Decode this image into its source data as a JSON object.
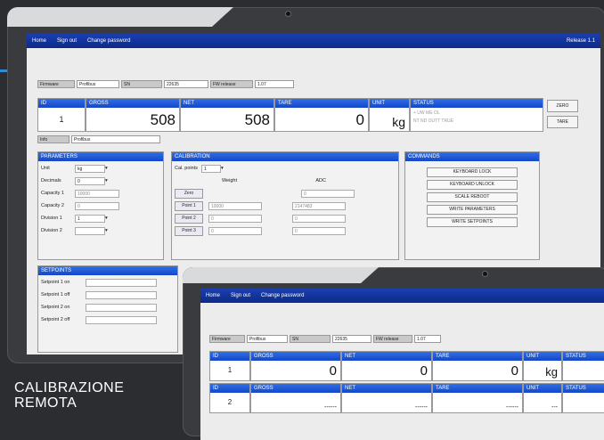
{
  "caption": {
    "line1": "CALIBRAZIONE",
    "line2": "REMOTA"
  },
  "nav": {
    "home": "Home",
    "sign_out": "Sign out",
    "change_password": "Change password",
    "version": "Release 1.1"
  },
  "info": {
    "f1_label": "Firmware",
    "f1_value": "Profibus",
    "f2_label": "SN",
    "f2_value": "22635",
    "f3_label": "FW release",
    "f3_value": "1.07"
  },
  "headers": {
    "id": "ID",
    "gross": "GROSS",
    "net": "NET",
    "tare": "TARE",
    "unit": "UNIT",
    "status": "STATUS"
  },
  "main_row": {
    "id": "1",
    "gross": "508",
    "net": "508",
    "tare": "0",
    "unit": "kg",
    "status_line1": "+ UW ME OL",
    "status_line2": "NT ND OUTT TRUE"
  },
  "side_buttons": {
    "zero": "ZERO",
    "tare": "TARE"
  },
  "name_row": {
    "label": "Info",
    "value": "Profibus"
  },
  "parameters": {
    "title": "PARAMETERS",
    "rows": [
      {
        "label": "Unit",
        "value": "kg"
      },
      {
        "label": "Decimals",
        "value": "0"
      },
      {
        "label": "Capacity 1",
        "value": "10000"
      },
      {
        "label": "Capacity 2",
        "value": "0"
      },
      {
        "label": "Division 1",
        "value": "1"
      },
      {
        "label": "Division 2",
        "value": ""
      }
    ]
  },
  "calibration": {
    "title": "CALIBRATION",
    "cal_points_label": "Cal. points",
    "cal_points_value": "1",
    "weight_header": "Weight",
    "adc_header": "ADC",
    "zero_label": "Zero",
    "zero_adc": "0",
    "points": [
      {
        "label": "Point 1",
        "weight": "10000",
        "adc": "2147483"
      },
      {
        "label": "Point 2",
        "weight": "0",
        "adc": "0"
      },
      {
        "label": "Point 3",
        "weight": "0",
        "adc": "0"
      }
    ]
  },
  "commands": {
    "title": "COMMANDS",
    "items": [
      "KEYBOARD LOCK",
      "KEYBOARD UNLOCK",
      "SCALE REBOOT",
      "WRITE PARAMETERS",
      "WRITE SETPOINTS"
    ]
  },
  "setpoints": {
    "title": "SETPOINTS",
    "rows": [
      "Setpoint 1 on",
      "Setpoint 1 off",
      "Setpoint 2 on",
      "Setpoint 2 off"
    ]
  },
  "device2": {
    "nav": {
      "home": "Home",
      "sign_out": "Sign out",
      "change_password": "Change password"
    },
    "info": {
      "f1_label": "Firmware",
      "f1_value": "Profibus",
      "f2_label": "SN",
      "f2_value": "22635",
      "f3_label": "FW release",
      "f3_value": "1.07"
    },
    "row1": {
      "id": "1",
      "gross": "0",
      "net": "0",
      "tare": "0",
      "unit": "kg"
    },
    "row2": {
      "id": "2",
      "gross": "------",
      "net": "------",
      "tare": "------",
      "unit": "---"
    }
  },
  "colors": {
    "accent": "#1447c8",
    "nav": "#0d2a8a",
    "stripe": "#2a8fd8"
  }
}
